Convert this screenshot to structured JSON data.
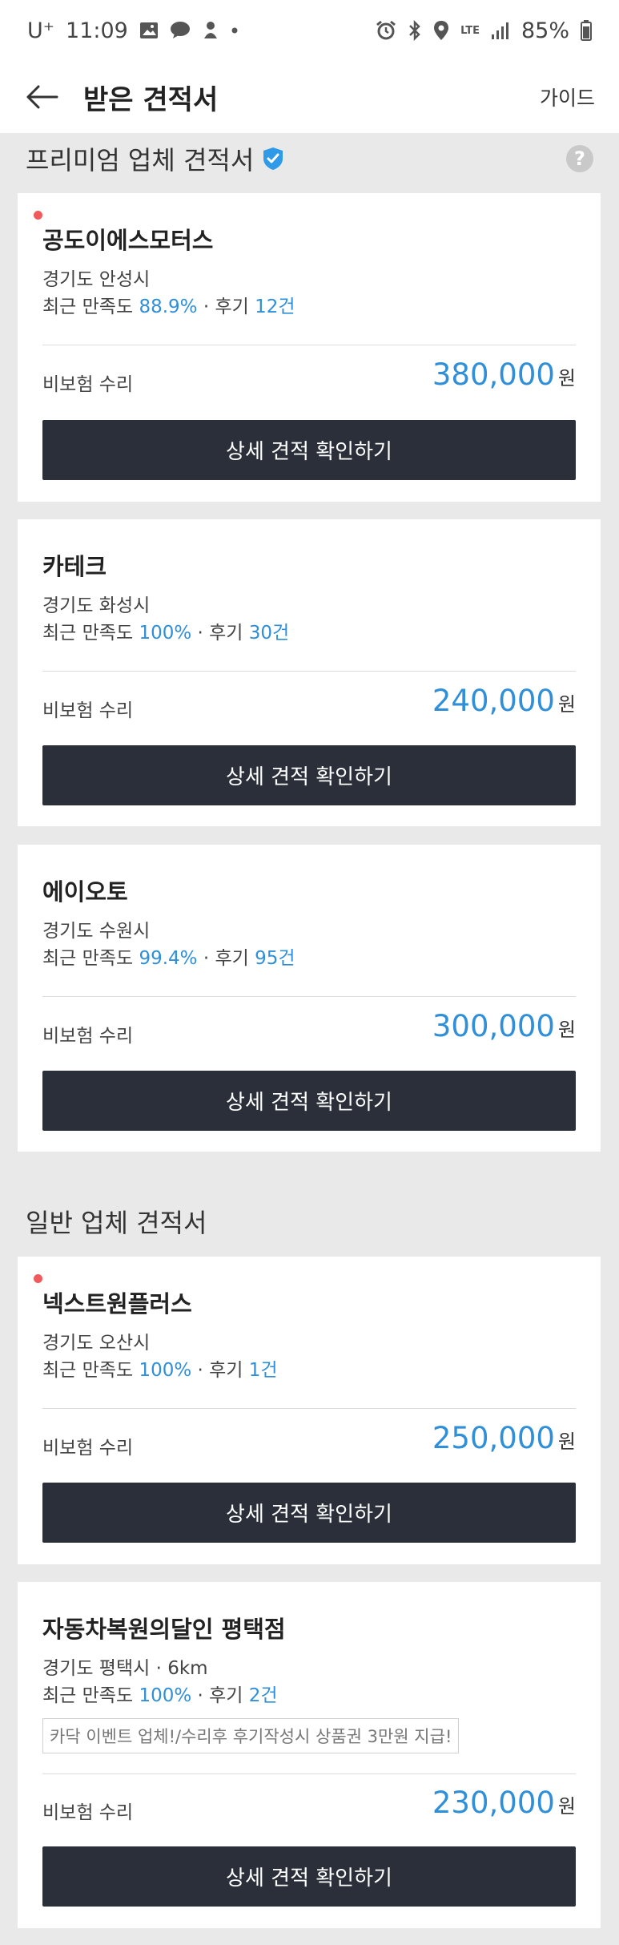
{
  "status_bar": {
    "carrier": "U⁺",
    "time": "11:09",
    "network": "LTE",
    "battery": "85%"
  },
  "header": {
    "title": "받은 견적서",
    "guide_label": "가이드"
  },
  "premium_section": {
    "title": "프리미엄 업체 견적서",
    "help_symbol": "?"
  },
  "general_section": {
    "title": "일반 업체 견적서"
  },
  "common": {
    "stat_prefix": "최근 만족도 ",
    "review_label": " · 후기 ",
    "cta_label": "상세 견적 확인하기",
    "currency": "원"
  },
  "quotes": [
    {
      "name": "공도이에스모터스",
      "location": "경기도 안성시",
      "satisfaction": "88.9%",
      "reviews": "12건",
      "repair_type": "비보험 수리",
      "price": "380,000",
      "new": true
    },
    {
      "name": "카테크",
      "location": "경기도 화성시",
      "satisfaction": "100%",
      "reviews": "30건",
      "repair_type": "비보험 수리",
      "price": "240,000",
      "new": false
    },
    {
      "name": "에이오토",
      "location": "경기도 수원시",
      "satisfaction": "99.4%",
      "reviews": "95건",
      "repair_type": "비보험 수리",
      "price": "300,000",
      "new": false
    },
    {
      "name": "넥스트원플러스",
      "location": "경기도 오산시",
      "satisfaction": "100%",
      "reviews": "1건",
      "repair_type": "비보험 수리",
      "price": "250,000",
      "new": true
    },
    {
      "name": "자동차복원의달인 평택점",
      "location": "경기도 평택시 · 6km",
      "satisfaction": "100%",
      "reviews": "2건",
      "repair_type": "비보험 수리",
      "price": "230,000",
      "new": false,
      "event": "카닥 이벤트 업체!/수리후 후기작성시 상품권 3만원 지급!"
    }
  ]
}
